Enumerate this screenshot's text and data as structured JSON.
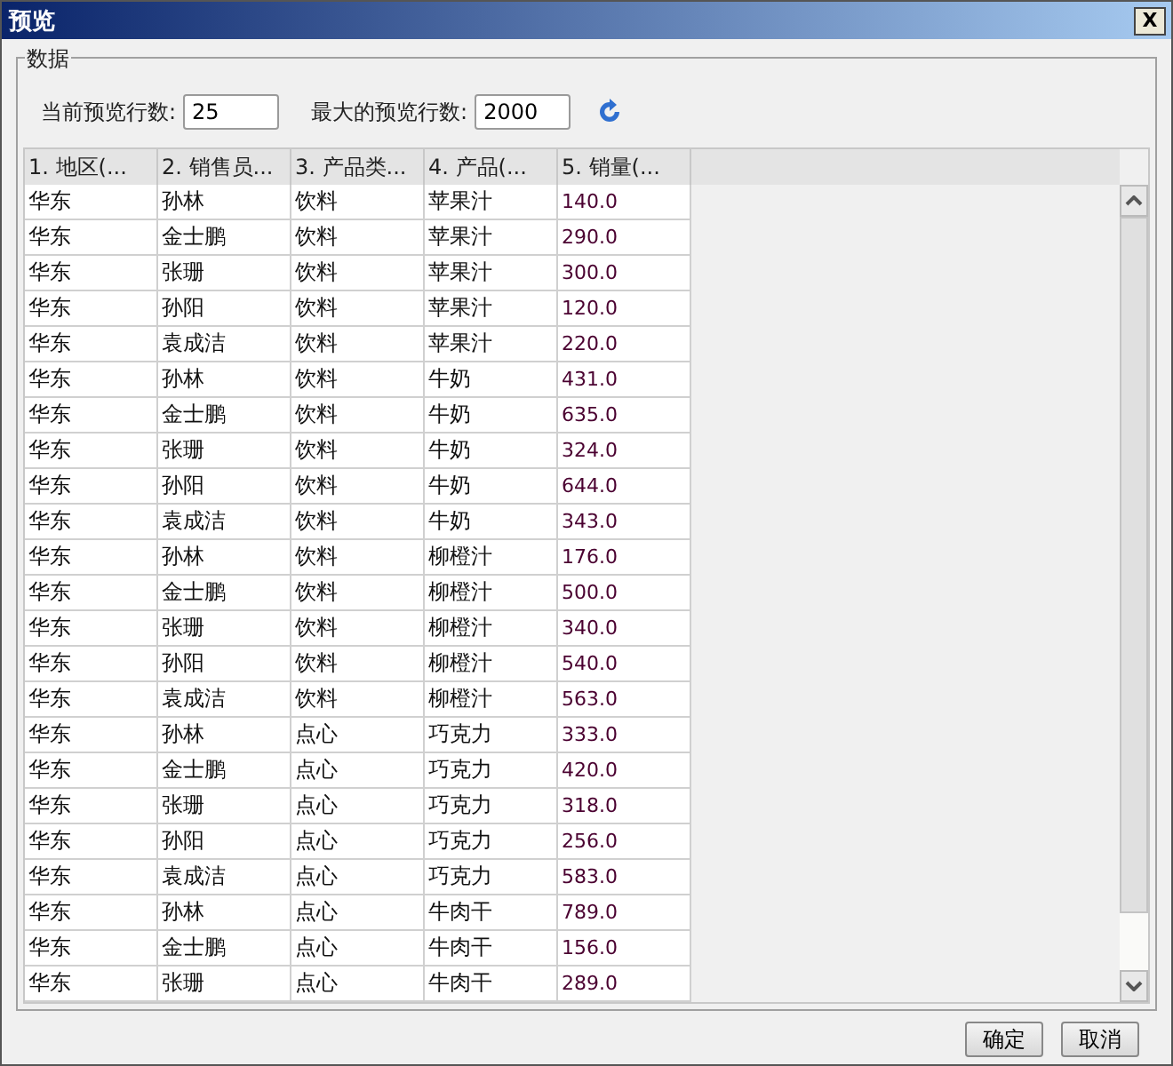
{
  "window": {
    "title": "预览",
    "close": "X"
  },
  "group": {
    "title": "数据"
  },
  "fields": [
    {
      "label": "当前预览行数:",
      "value": "25"
    },
    {
      "label": "最大的预览行数:",
      "value": "2000"
    }
  ],
  "table": {
    "columns": [
      "1. 地区(...",
      "2. 销售员...",
      "3. 产品类...",
      "4. 产品(...",
      "5. 销量(..."
    ],
    "rows": [
      [
        "华东",
        "孙林",
        "饮料",
        "苹果汁",
        "140.0"
      ],
      [
        "华东",
        "金士鹏",
        "饮料",
        "苹果汁",
        "290.0"
      ],
      [
        "华东",
        "张珊",
        "饮料",
        "苹果汁",
        "300.0"
      ],
      [
        "华东",
        "孙阳",
        "饮料",
        "苹果汁",
        "120.0"
      ],
      [
        "华东",
        "袁成洁",
        "饮料",
        "苹果汁",
        "220.0"
      ],
      [
        "华东",
        "孙林",
        "饮料",
        "牛奶",
        "431.0"
      ],
      [
        "华东",
        "金士鹏",
        "饮料",
        "牛奶",
        "635.0"
      ],
      [
        "华东",
        "张珊",
        "饮料",
        "牛奶",
        "324.0"
      ],
      [
        "华东",
        "孙阳",
        "饮料",
        "牛奶",
        "644.0"
      ],
      [
        "华东",
        "袁成洁",
        "饮料",
        "牛奶",
        "343.0"
      ],
      [
        "华东",
        "孙林",
        "饮料",
        "柳橙汁",
        "176.0"
      ],
      [
        "华东",
        "金士鹏",
        "饮料",
        "柳橙汁",
        "500.0"
      ],
      [
        "华东",
        "张珊",
        "饮料",
        "柳橙汁",
        "340.0"
      ],
      [
        "华东",
        "孙阳",
        "饮料",
        "柳橙汁",
        "540.0"
      ],
      [
        "华东",
        "袁成洁",
        "饮料",
        "柳橙汁",
        "563.0"
      ],
      [
        "华东",
        "孙林",
        "点心",
        "巧克力",
        "333.0"
      ],
      [
        "华东",
        "金士鹏",
        "点心",
        "巧克力",
        "420.0"
      ],
      [
        "华东",
        "张珊",
        "点心",
        "巧克力",
        "318.0"
      ],
      [
        "华东",
        "孙阳",
        "点心",
        "巧克力",
        "256.0"
      ],
      [
        "华东",
        "袁成洁",
        "点心",
        "巧克力",
        "583.0"
      ],
      [
        "华东",
        "孙林",
        "点心",
        "牛肉干",
        "789.0"
      ],
      [
        "华东",
        "金士鹏",
        "点心",
        "牛肉干",
        "156.0"
      ],
      [
        "华东",
        "张珊",
        "点心",
        "牛肉干",
        "289.0"
      ]
    ]
  },
  "buttons": [
    "确定",
    "取消"
  ]
}
